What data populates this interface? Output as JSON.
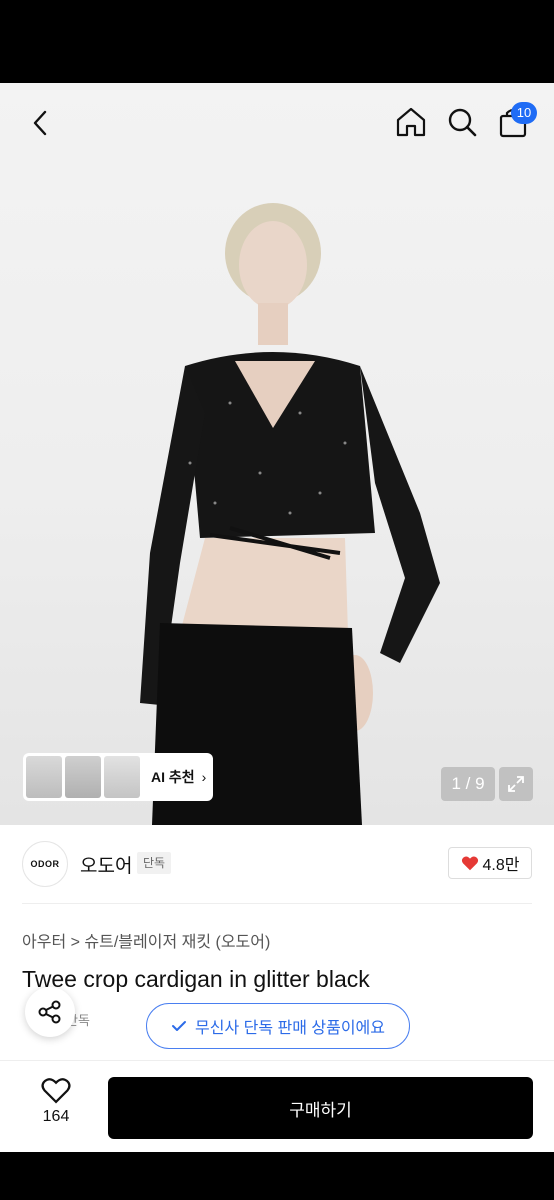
{
  "header": {
    "cart_count": "10"
  },
  "gallery": {
    "ai_label": "AI 추천",
    "counter": "1 / 9"
  },
  "brand": {
    "logo_text": "ODOR",
    "name": "오도어",
    "tag": "단독",
    "rating": "4.8만"
  },
  "product": {
    "breadcrumb": "아우터 > 슈트/블레이저 재킷 (오도어)",
    "title": "Twee crop cardigan in glitter black",
    "exclusive_tag": "단독"
  },
  "toast": {
    "text": "무신사 단독 판매 상품이에요"
  },
  "bottom": {
    "like_count": "164",
    "buy_label": "구매하기"
  },
  "colors": {
    "accent_blue": "#1f6cf5",
    "heart_red": "#e53935",
    "buy_button": "#000000"
  }
}
